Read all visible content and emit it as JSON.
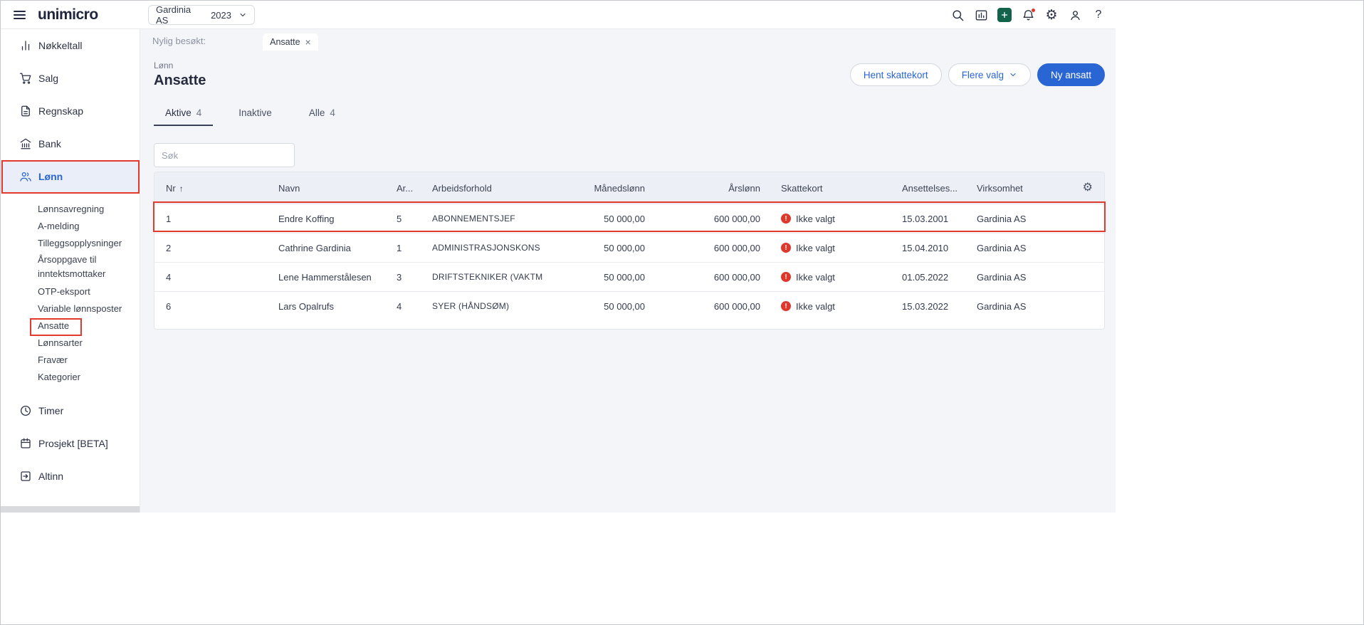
{
  "glyphs": {
    "gear": "⚙",
    "help": "?",
    "sort_asc": "↑",
    "close": "×",
    "exclaim": "!"
  },
  "topbar": {
    "logo": "unimicro",
    "company": "Gardinia AS",
    "year": "2023"
  },
  "sidebar": {
    "items": [
      {
        "label": "Nøkkeltall"
      },
      {
        "label": "Salg"
      },
      {
        "label": "Regnskap"
      },
      {
        "label": "Bank"
      },
      {
        "label": "Lønn"
      }
    ],
    "submenu": [
      "Lønnsavregning",
      "A-melding",
      "Tilleggsopplysninger",
      "Årsoppgave til inntektsmottaker",
      "OTP-eksport",
      "Variable lønnsposter",
      "Ansatte",
      "Lønnsarter",
      "Fravær",
      "Kategorier"
    ],
    "bottom_items": [
      "Timer",
      "Prosjekt [BETA]",
      "Altinn"
    ]
  },
  "recent": {
    "label": "Nylig besøkt:",
    "tab": "Ansatte"
  },
  "page": {
    "breadcrumb": "Lønn",
    "title": "Ansatte",
    "hent_button": "Hent skattekort",
    "flere_button": "Flere valg",
    "ny_button": "Ny ansatt"
  },
  "tabs": {
    "aktive": "Aktive",
    "aktive_count": "4",
    "inaktive": "Inaktive",
    "alle": "Alle",
    "alle_count": "4"
  },
  "search": {
    "placeholder": "Søk"
  },
  "table": {
    "headers": {
      "nr": "Nr",
      "navn": "Navn",
      "ar": "Ar...",
      "arbeidsforhold": "Arbeidsforhold",
      "manedslonn": "Månedslønn",
      "arslonn": "Årslønn",
      "skattekort": "Skattekort",
      "ansettelses": "Ansettelses...",
      "virksomhet": "Virksomhet"
    },
    "rows": [
      {
        "nr": "1",
        "navn": "Endre Koffing",
        "ar": "5",
        "arbeidsforhold": "ABONNEMENTSJEF",
        "manedslonn": "50 000,00",
        "arslonn": "600 000,00",
        "skattekort": "Ikke valgt",
        "ansettelses": "15.03.2001",
        "virksomhet": "Gardinia AS"
      },
      {
        "nr": "2",
        "navn": "Cathrine Gardinia",
        "ar": "1",
        "arbeidsforhold": "ADMINISTRASJONSKONS",
        "manedslonn": "50 000,00",
        "arslonn": "600 000,00",
        "skattekort": "Ikke valgt",
        "ansettelses": "15.04.2010",
        "virksomhet": "Gardinia AS"
      },
      {
        "nr": "4",
        "navn": "Lene Hammerstålesen",
        "ar": "3",
        "arbeidsforhold": "DRIFTSTEKNIKER (VAKTM",
        "manedslonn": "50 000,00",
        "arslonn": "600 000,00",
        "skattekort": "Ikke valgt",
        "ansettelses": "01.05.2022",
        "virksomhet": "Gardinia AS"
      },
      {
        "nr": "6",
        "navn": "Lars Opalrufs",
        "ar": "4",
        "arbeidsforhold": "SYER (HÅNDSØM)",
        "manedslonn": "50 000,00",
        "arslonn": "600 000,00",
        "skattekort": "Ikke valgt",
        "ansettelses": "15.03.2022",
        "virksomhet": "Gardinia AS"
      }
    ]
  }
}
